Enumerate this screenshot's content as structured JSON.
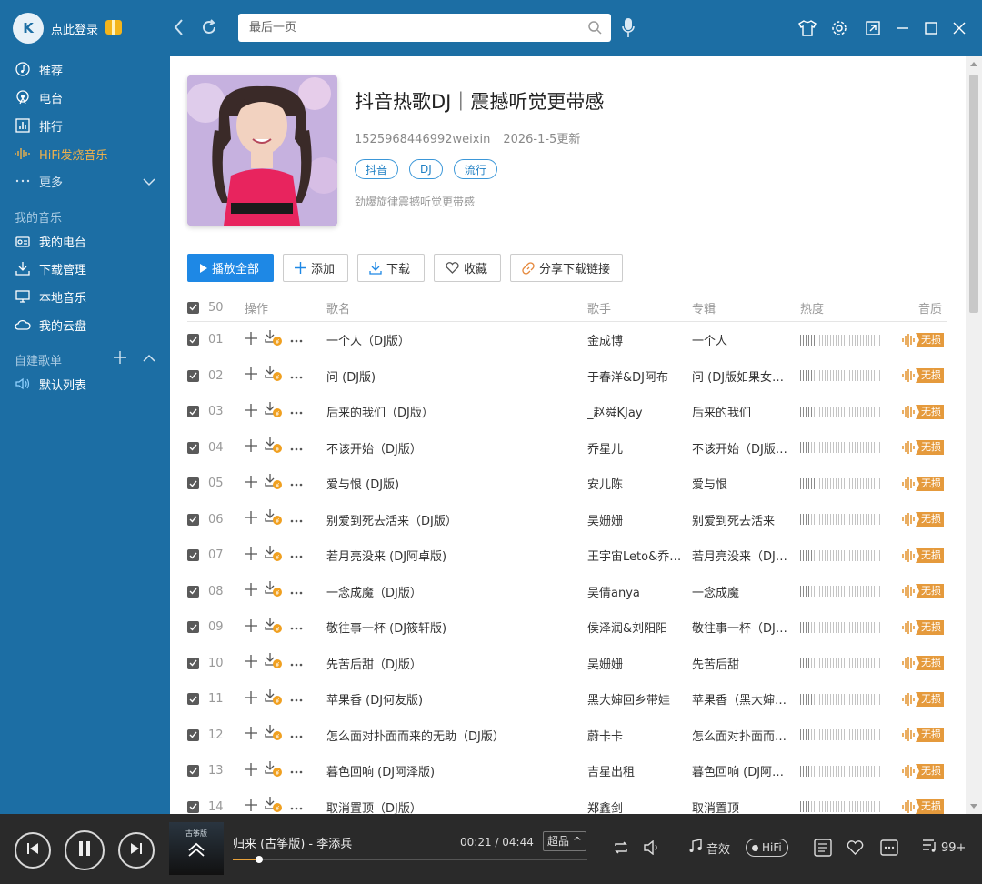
{
  "header": {
    "logo_text": "K",
    "login_label": "点此登录",
    "search_placeholder": "最后一页"
  },
  "sidebar": {
    "nav": [
      {
        "label": "推荐",
        "icon": "music-note-circle-icon"
      },
      {
        "label": "电台",
        "icon": "radio-icon"
      },
      {
        "label": "排行",
        "icon": "chart-icon"
      },
      {
        "label": "HiFi发烧音乐",
        "icon": "hifi-wave-icon"
      },
      {
        "label": "更多",
        "icon": "more-dots-icon"
      }
    ],
    "my_music_title": "我的音乐",
    "my_music": [
      {
        "label": "我的电台",
        "icon": "radio-box-icon"
      },
      {
        "label": "下载管理",
        "icon": "download-icon"
      },
      {
        "label": "本地音乐",
        "icon": "monitor-icon"
      },
      {
        "label": "我的云盘",
        "icon": "cloud-icon"
      }
    ],
    "playlist_title": "自建歌单",
    "playlists": [
      {
        "label": "默认列表",
        "icon": "speaker-icon"
      }
    ]
  },
  "playlist": {
    "title": "抖音热歌DJ｜震撼听觉更带感",
    "creator": "1525968446992weixin",
    "updated": "2026-1-5更新",
    "tags": [
      "抖音",
      "DJ",
      "流行"
    ],
    "description": "劲爆旋律震撼听觉更带感"
  },
  "actions": {
    "play_all": "播放全部",
    "add": "添加",
    "download": "下载",
    "favorite": "收藏",
    "share": "分享下载链接"
  },
  "table": {
    "count": "50",
    "headers": {
      "ops": "操作",
      "name": "歌名",
      "artist": "歌手",
      "album": "专辑",
      "heat": "热度",
      "quality": "音质"
    },
    "quality_label": "无损",
    "rows": [
      {
        "num": "01",
        "name": "一个人（DJ版）",
        "artist": "金成博",
        "album": "一个人",
        "heat": 0.18
      },
      {
        "num": "02",
        "name": "问 (DJ版)",
        "artist": "于春洋&DJ阿布",
        "album": "问 (DJ版如果女…",
        "heat": 0.16
      },
      {
        "num": "03",
        "name": "后来的我们（DJ版）",
        "artist": "_赵舜KJay",
        "album": "后来的我们",
        "heat": 0.15
      },
      {
        "num": "04",
        "name": "不该开始（DJ版）",
        "artist": "乔星儿",
        "album": "不该开始（DJ版…",
        "heat": 0.14
      },
      {
        "num": "05",
        "name": "爱与恨 (DJ版)",
        "artist": "安儿陈",
        "album": "爱与恨",
        "heat": 0.2
      },
      {
        "num": "06",
        "name": "别爱到死去活来（DJ版）",
        "artist": "吴姗姗",
        "album": "别爱到死去活来",
        "heat": 0.13
      },
      {
        "num": "07",
        "name": "若月亮没来 (DJ阿卓版)",
        "artist": "王宇宙Leto&乔…",
        "album": "若月亮没来（DJ…",
        "heat": 0.15
      },
      {
        "num": "08",
        "name": "一念成魔（DJ版）",
        "artist": "吴倩anya",
        "album": "一念成魔",
        "heat": 0.12
      },
      {
        "num": "09",
        "name": "敬往事一杯 (DJ筱轩版)",
        "artist": "侯泽润&刘阳阳",
        "album": "敬往事一杯（DJ…",
        "heat": 0.14
      },
      {
        "num": "10",
        "name": "先苦后甜（DJ版）",
        "artist": "吴姗姗",
        "album": "先苦后甜",
        "heat": 0.13
      },
      {
        "num": "11",
        "name": "苹果香 (DJ何友版)",
        "artist": "黑大婶回乡带娃",
        "album": "苹果香（黑大婶…",
        "heat": 0.17
      },
      {
        "num": "12",
        "name": "怎么面对扑面而来的无助（DJ版）",
        "artist": "蔚卡卡",
        "album": "怎么面对扑面而…",
        "heat": 0.12
      },
      {
        "num": "13",
        "name": "暮色回响 (DJ阿泽版)",
        "artist": "吉星出租",
        "album": "暮色回响 (DJ阿…",
        "heat": 0.11
      },
      {
        "num": "14",
        "name": "取消置顶（DJ版）",
        "artist": "郑鑫剑",
        "album": "取消置顶",
        "heat": 0.13
      }
    ]
  },
  "player": {
    "song": "归来 (古筝版) - 李添兵",
    "time": "00:21 / 04:44",
    "progress": 0.074,
    "quality": "超品 ^",
    "effects_label": "音效",
    "hifi_label": "HiFi",
    "playlist_count": "99+",
    "thumb_text": "古筝版"
  }
}
